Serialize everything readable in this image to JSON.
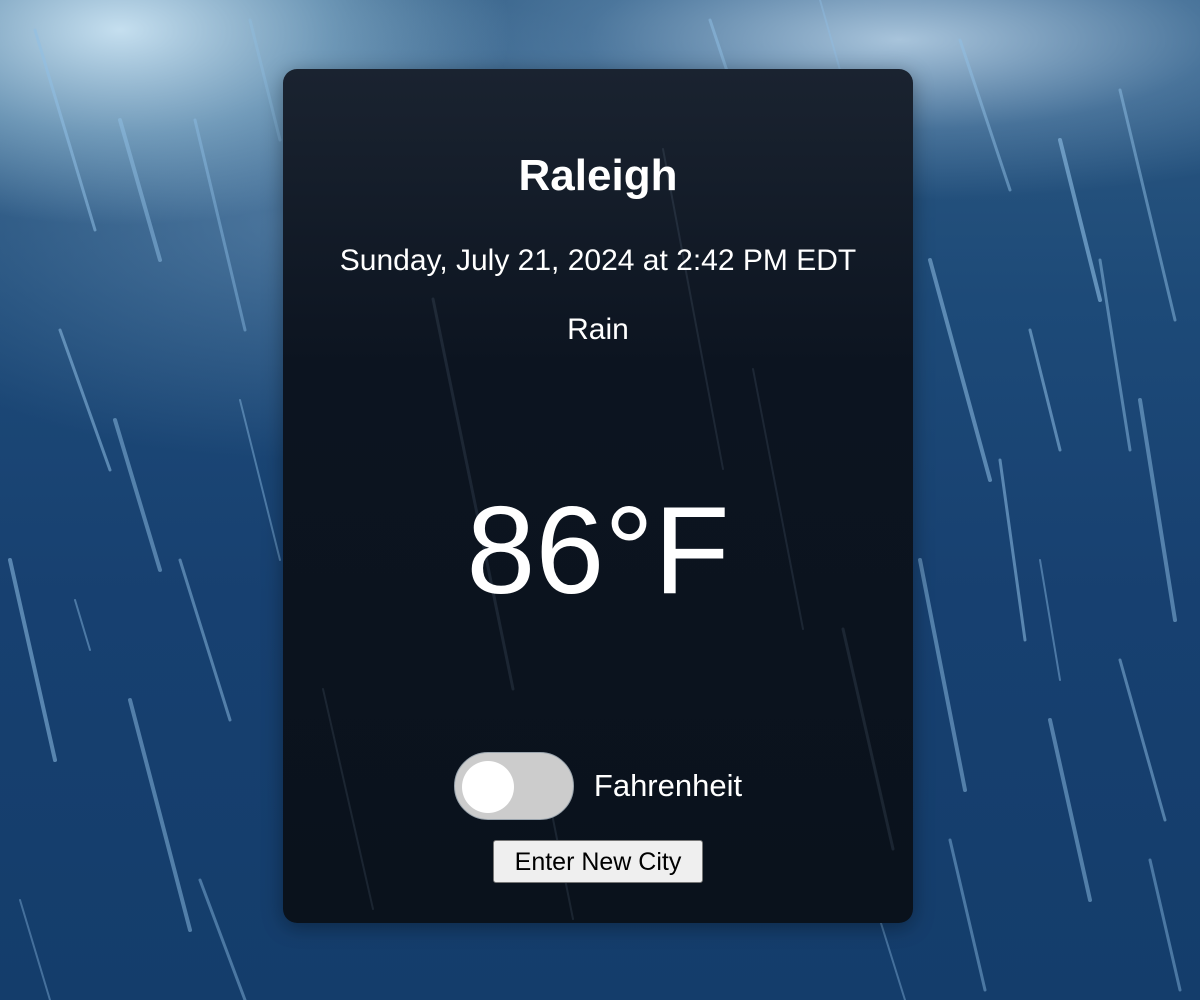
{
  "weather": {
    "city": "Raleigh",
    "datetime": "Sunday, July 21, 2024 at 2:42 PM EDT",
    "condition": "Rain",
    "temperature": "86°F"
  },
  "unit_toggle": {
    "label": "Fahrenheit",
    "checked": false
  },
  "actions": {
    "new_city_label": "Enter New City"
  },
  "background": {
    "theme": "rain",
    "icon": "rain-streaks"
  },
  "colors": {
    "card_bg": "#0b131d",
    "text": "#ffffff",
    "toggle_track": "#cccccc",
    "toggle_knob": "#ffffff",
    "button_bg": "#efefef"
  }
}
